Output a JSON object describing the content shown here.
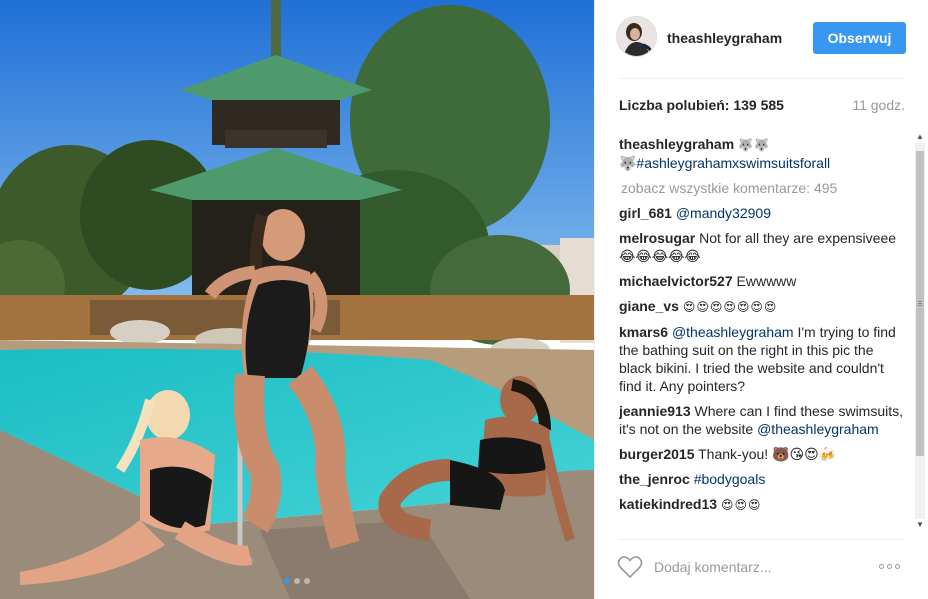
{
  "post": {
    "author": "theashleygraham",
    "follow_label": "Obserwuj",
    "likes_label": "Liczba polubień:",
    "likes_count": "139 585",
    "time": "11 godz.",
    "caption_user": "theashleygraham",
    "caption_emoji": "🐺🐺",
    "caption_text": "🐺#ashleygrahamxswimsuitsforall",
    "view_all_comments": "zobacz wszystkie komentarze: 495",
    "add_comment_placeholder": "Dodaj komentarz...",
    "carousel": {
      "slides": 3,
      "active_index": 0
    }
  },
  "comments": [
    {
      "user": "girl_681",
      "mention": "@mandy32909",
      "text": ""
    },
    {
      "user": "melrosugar",
      "mention": "",
      "text": "Not for all they are expensiveee 😂😂😂😂😂"
    },
    {
      "user": "michaelvictor527",
      "mention": "",
      "text": "Ewwwww"
    },
    {
      "user": "giane_vs",
      "mention": "",
      "text": "😍😍😍😍😍😍😍"
    },
    {
      "user": "kmars6",
      "mention": "@theashleygraham",
      "text": "I'm trying to find the bathing suit on the right in this pic the black bikini. I tried the website and couldn't find it. Any pointers?"
    },
    {
      "user": "jeannie913",
      "mention": "",
      "text": "Where can I find these swimsuits, it's not on the website",
      "trailing_mention": "@theashleygraham"
    },
    {
      "user": "burger2015",
      "mention": "",
      "text": "Thank-you! 🐻😘😍🍻"
    },
    {
      "user": "the_jenroc",
      "mention": "",
      "text": "",
      "tag": "#bodygoals"
    },
    {
      "user": "katiekindred13",
      "mention": "",
      "text": "😍😍😍"
    }
  ],
  "colors": {
    "follow_button": "#3897f0",
    "mention": "#003569",
    "muted_text": "#999999"
  },
  "icons": {
    "like": "heart-outline-icon",
    "more": "more-options-icon"
  }
}
